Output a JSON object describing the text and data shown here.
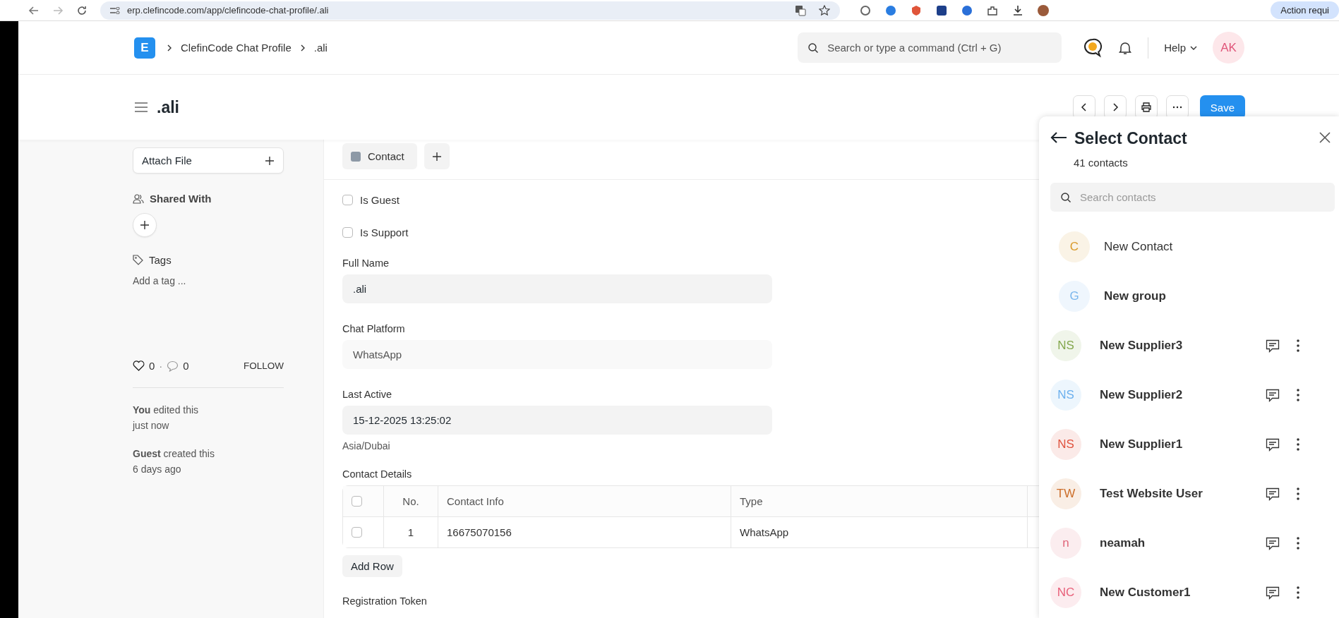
{
  "browser": {
    "url": "erp.clefincode.com/app/clefincode-chat-profile/.ali",
    "action_button": "Action requi"
  },
  "navbar": {
    "logo": "E",
    "breadcrumbs": [
      "ClefinCode Chat Profile",
      ".ali"
    ],
    "search": {
      "placeholder": "Search or type a command (Ctrl + G)"
    },
    "help": "Help",
    "avatar": "AK"
  },
  "page_head": {
    "title": ".ali",
    "save": "Save"
  },
  "sidebar": {
    "attach": "Attach File",
    "shared_with": "Shared With",
    "tags": "Tags",
    "add_tag": "Add a tag ...",
    "likes": "0",
    "separator": "·",
    "comments": "0",
    "follow": "FOLLOW",
    "activity": [
      {
        "text": "**You** edited this",
        "time": "just now"
      },
      {
        "text": "**Guest** created this",
        "time": "6 days ago"
      }
    ]
  },
  "form": {
    "sections": [
      {
        "label": "Contact"
      }
    ],
    "checkboxes": [
      {
        "label": "Is Guest",
        "checked": false
      },
      {
        "label": "Is Support",
        "checked": false
      }
    ],
    "fields": [
      {
        "label": "Full Name",
        "value": ".ali",
        "read_only": false
      },
      {
        "label": "Chat Platform",
        "value": "WhatsApp",
        "read_only": true
      },
      {
        "label": "Last Active",
        "value": "15-12-2025 13:25:02",
        "read_only": false,
        "description": "Asia/Dubai"
      }
    ],
    "table": {
      "label": "Contact Details",
      "all_selected": false,
      "columns": [
        "No.",
        "Contact Info",
        "Type"
      ],
      "rows": [
        {
          "selected": false,
          "cells": [
            "1",
            "16675070156",
            "WhatsApp"
          ]
        }
      ],
      "add_row": "Add Row"
    },
    "next_label": "Registration Token"
  },
  "panel": {
    "title": "Select Contact",
    "count": "41 contacts",
    "search": {
      "placeholder": "Search contacts"
    },
    "items": [
      {
        "kind": "action",
        "initials": "C",
        "name": "New Contact",
        "color": "#d99a2b",
        "bold": false
      },
      {
        "kind": "action",
        "initials": "G",
        "name": "New group",
        "color": "#7ab6ec",
        "bold": true
      },
      {
        "kind": "contact",
        "initials": "NS",
        "name": "New Supplier3",
        "color": "#84a84e",
        "bold": true
      },
      {
        "kind": "contact",
        "initials": "NS",
        "name": "New Supplier2",
        "color": "#6cb0ee",
        "bold": true
      },
      {
        "kind": "contact",
        "initials": "NS",
        "name": "New Supplier1",
        "color": "#e0533f",
        "bold": true
      },
      {
        "kind": "contact",
        "initials": "TW",
        "name": "Test Website User",
        "color": "#cc6e2a",
        "bold": true
      },
      {
        "kind": "contact",
        "initials": "n",
        "name": "neamah",
        "color": "#e0667a",
        "bold": true
      },
      {
        "kind": "contact",
        "initials": "NC",
        "name": "New Customer1",
        "color": "#e8607a",
        "bold": true
      }
    ]
  }
}
